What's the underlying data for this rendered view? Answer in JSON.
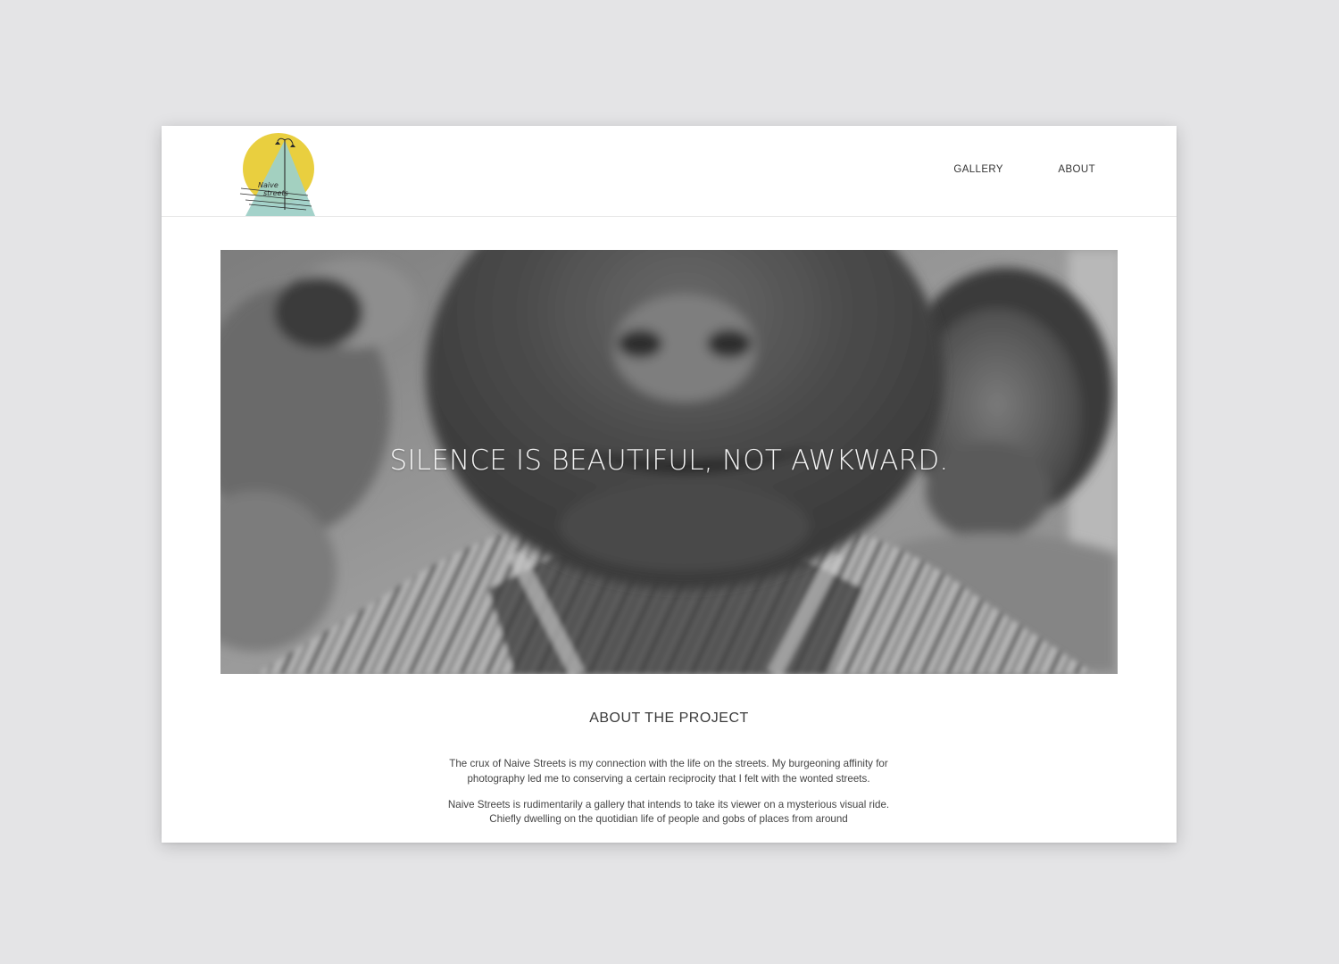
{
  "site": {
    "logo_text": "Naive streets"
  },
  "nav": {
    "items": [
      {
        "label": "GALLERY"
      },
      {
        "label": "ABOUT"
      }
    ]
  },
  "hero": {
    "quote": "SILENCE IS BEAUTIFUL, NOT AWKWARD."
  },
  "about": {
    "title": "ABOUT THE PROJECT",
    "paragraphs": [
      "The crux of Naive Streets is my connection with the life on the streets. My burgeoning affinity for photography led me to conserving a certain reciprocity that I felt with the wonted streets.",
      "Naive Streets is rudimentarily a gallery that intends to take its viewer on a mysterious visual ride. Chiefly dwelling on the quotidian life of people and gobs of places from around"
    ]
  },
  "colors": {
    "logo_circle": "#e9cf3f",
    "logo_triangle": "#9fd0c7",
    "page_background": "#e4e4e6",
    "text": "#333333"
  }
}
